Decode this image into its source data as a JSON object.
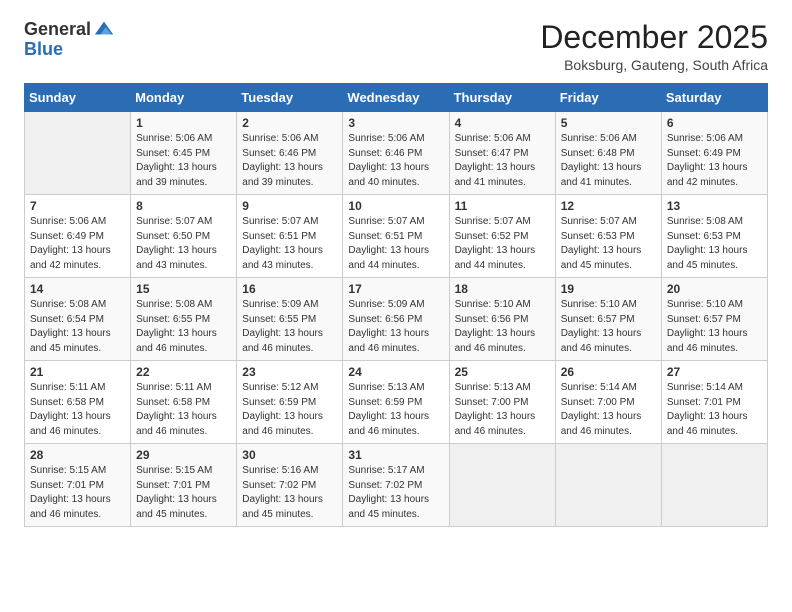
{
  "header": {
    "logo_general": "General",
    "logo_blue": "Blue",
    "month_title": "December 2025",
    "subtitle": "Boksburg, Gauteng, South Africa"
  },
  "weekdays": [
    "Sunday",
    "Monday",
    "Tuesday",
    "Wednesday",
    "Thursday",
    "Friday",
    "Saturday"
  ],
  "weeks": [
    [
      {
        "day": "",
        "info": ""
      },
      {
        "day": "1",
        "info": "Sunrise: 5:06 AM\nSunset: 6:45 PM\nDaylight: 13 hours\nand 39 minutes."
      },
      {
        "day": "2",
        "info": "Sunrise: 5:06 AM\nSunset: 6:46 PM\nDaylight: 13 hours\nand 39 minutes."
      },
      {
        "day": "3",
        "info": "Sunrise: 5:06 AM\nSunset: 6:46 PM\nDaylight: 13 hours\nand 40 minutes."
      },
      {
        "day": "4",
        "info": "Sunrise: 5:06 AM\nSunset: 6:47 PM\nDaylight: 13 hours\nand 41 minutes."
      },
      {
        "day": "5",
        "info": "Sunrise: 5:06 AM\nSunset: 6:48 PM\nDaylight: 13 hours\nand 41 minutes."
      },
      {
        "day": "6",
        "info": "Sunrise: 5:06 AM\nSunset: 6:49 PM\nDaylight: 13 hours\nand 42 minutes."
      }
    ],
    [
      {
        "day": "7",
        "info": "Sunrise: 5:06 AM\nSunset: 6:49 PM\nDaylight: 13 hours\nand 42 minutes."
      },
      {
        "day": "8",
        "info": "Sunrise: 5:07 AM\nSunset: 6:50 PM\nDaylight: 13 hours\nand 43 minutes."
      },
      {
        "day": "9",
        "info": "Sunrise: 5:07 AM\nSunset: 6:51 PM\nDaylight: 13 hours\nand 43 minutes."
      },
      {
        "day": "10",
        "info": "Sunrise: 5:07 AM\nSunset: 6:51 PM\nDaylight: 13 hours\nand 44 minutes."
      },
      {
        "day": "11",
        "info": "Sunrise: 5:07 AM\nSunset: 6:52 PM\nDaylight: 13 hours\nand 44 minutes."
      },
      {
        "day": "12",
        "info": "Sunrise: 5:07 AM\nSunset: 6:53 PM\nDaylight: 13 hours\nand 45 minutes."
      },
      {
        "day": "13",
        "info": "Sunrise: 5:08 AM\nSunset: 6:53 PM\nDaylight: 13 hours\nand 45 minutes."
      }
    ],
    [
      {
        "day": "14",
        "info": "Sunrise: 5:08 AM\nSunset: 6:54 PM\nDaylight: 13 hours\nand 45 minutes."
      },
      {
        "day": "15",
        "info": "Sunrise: 5:08 AM\nSunset: 6:55 PM\nDaylight: 13 hours\nand 46 minutes."
      },
      {
        "day": "16",
        "info": "Sunrise: 5:09 AM\nSunset: 6:55 PM\nDaylight: 13 hours\nand 46 minutes."
      },
      {
        "day": "17",
        "info": "Sunrise: 5:09 AM\nSunset: 6:56 PM\nDaylight: 13 hours\nand 46 minutes."
      },
      {
        "day": "18",
        "info": "Sunrise: 5:10 AM\nSunset: 6:56 PM\nDaylight: 13 hours\nand 46 minutes."
      },
      {
        "day": "19",
        "info": "Sunrise: 5:10 AM\nSunset: 6:57 PM\nDaylight: 13 hours\nand 46 minutes."
      },
      {
        "day": "20",
        "info": "Sunrise: 5:10 AM\nSunset: 6:57 PM\nDaylight: 13 hours\nand 46 minutes."
      }
    ],
    [
      {
        "day": "21",
        "info": "Sunrise: 5:11 AM\nSunset: 6:58 PM\nDaylight: 13 hours\nand 46 minutes."
      },
      {
        "day": "22",
        "info": "Sunrise: 5:11 AM\nSunset: 6:58 PM\nDaylight: 13 hours\nand 46 minutes."
      },
      {
        "day": "23",
        "info": "Sunrise: 5:12 AM\nSunset: 6:59 PM\nDaylight: 13 hours\nand 46 minutes."
      },
      {
        "day": "24",
        "info": "Sunrise: 5:13 AM\nSunset: 6:59 PM\nDaylight: 13 hours\nand 46 minutes."
      },
      {
        "day": "25",
        "info": "Sunrise: 5:13 AM\nSunset: 7:00 PM\nDaylight: 13 hours\nand 46 minutes."
      },
      {
        "day": "26",
        "info": "Sunrise: 5:14 AM\nSunset: 7:00 PM\nDaylight: 13 hours\nand 46 minutes."
      },
      {
        "day": "27",
        "info": "Sunrise: 5:14 AM\nSunset: 7:01 PM\nDaylight: 13 hours\nand 46 minutes."
      }
    ],
    [
      {
        "day": "28",
        "info": "Sunrise: 5:15 AM\nSunset: 7:01 PM\nDaylight: 13 hours\nand 46 minutes."
      },
      {
        "day": "29",
        "info": "Sunrise: 5:15 AM\nSunset: 7:01 PM\nDaylight: 13 hours\nand 45 minutes."
      },
      {
        "day": "30",
        "info": "Sunrise: 5:16 AM\nSunset: 7:02 PM\nDaylight: 13 hours\nand 45 minutes."
      },
      {
        "day": "31",
        "info": "Sunrise: 5:17 AM\nSunset: 7:02 PM\nDaylight: 13 hours\nand 45 minutes."
      },
      {
        "day": "",
        "info": ""
      },
      {
        "day": "",
        "info": ""
      },
      {
        "day": "",
        "info": ""
      }
    ]
  ]
}
